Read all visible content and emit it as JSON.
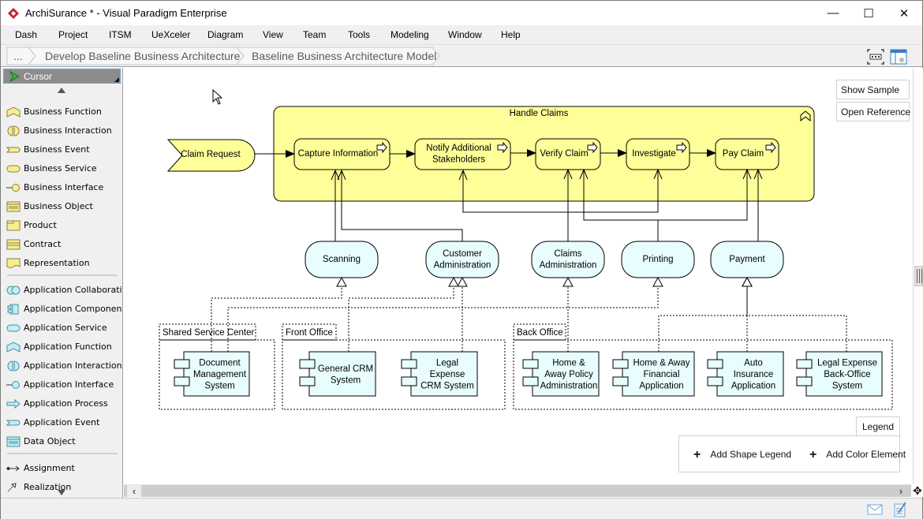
{
  "window": {
    "title": "ArchiSurance * - Visual Paradigm Enterprise",
    "controls": {
      "minimize": "—",
      "maximize": "☐",
      "close": "✕"
    }
  },
  "menu": [
    "Dash",
    "Project",
    "ITSM",
    "UeXceler",
    "Diagram",
    "View",
    "Team",
    "Tools",
    "Modeling",
    "Window",
    "Help"
  ],
  "breadcrumb": {
    "ellipsis": "...",
    "items": [
      "Develop Baseline Business Architecture",
      "Baseline Business Architecture Model"
    ]
  },
  "toolbar": {
    "icons": [
      "fit-diagram-icon",
      "diagram-navigator-icon"
    ]
  },
  "palette": {
    "cursor_label": "Cursor",
    "groups": [
      [
        {
          "label": "Business Function",
          "icon": "business-function-icon"
        },
        {
          "label": "Business Interaction",
          "icon": "business-interaction-icon"
        },
        {
          "label": "Business Event",
          "icon": "business-event-icon"
        },
        {
          "label": "Business Service",
          "icon": "business-service-icon"
        },
        {
          "label": "Business Interface",
          "icon": "business-interface-icon"
        },
        {
          "label": "Business Object",
          "icon": "business-object-icon"
        },
        {
          "label": "Product",
          "icon": "product-icon"
        },
        {
          "label": "Contract",
          "icon": "contract-icon"
        },
        {
          "label": "Representation",
          "icon": "representation-icon"
        }
      ],
      [
        {
          "label": "Application Collaboration",
          "icon": "application-collaboration-icon"
        },
        {
          "label": "Application Component",
          "icon": "application-component-icon"
        },
        {
          "label": "Application Service",
          "icon": "application-service-icon"
        },
        {
          "label": "Application Function",
          "icon": "application-function-icon"
        },
        {
          "label": "Application Interaction",
          "icon": "application-interaction-icon"
        },
        {
          "label": "Application Interface",
          "icon": "application-interface-icon"
        },
        {
          "label": "Application Process",
          "icon": "application-process-icon"
        },
        {
          "label": "Application Event",
          "icon": "application-event-icon"
        },
        {
          "label": "Data Object",
          "icon": "data-object-icon"
        }
      ],
      [
        {
          "label": "Assignment",
          "icon": "assignment-icon"
        },
        {
          "label": "Realization",
          "icon": "realization-icon"
        }
      ]
    ]
  },
  "side_buttons": {
    "show_sample": "Show Sample",
    "open_reference": "Open Reference"
  },
  "diagram": {
    "colors": {
      "business": "#ffff99",
      "application": "#e8fdfd",
      "stroke": "#000000"
    },
    "event": "Claim Request",
    "process_group": "Handle Claims",
    "processes": [
      "Capture Information",
      "Notify Additional Stakeholders",
      "Verify Claim",
      "Investigate",
      "Pay Claim"
    ],
    "services": [
      "Scanning",
      "Customer Administration",
      "Claims Administration",
      "Printing",
      "Payment"
    ],
    "groups": [
      "Shared Service Center",
      "Front Office",
      "Back Office"
    ],
    "components": [
      "Document Management System",
      "General CRM System",
      "Legal Expense CRM System",
      "Home & Away Policy Administration",
      "Home & Away Financial Application",
      "Auto Insurance Application",
      "Legal Expense Back-Office System"
    ]
  },
  "legend": {
    "tab": "Legend",
    "add_shape": "Add Shape Legend",
    "add_color": "Add Color Element"
  }
}
